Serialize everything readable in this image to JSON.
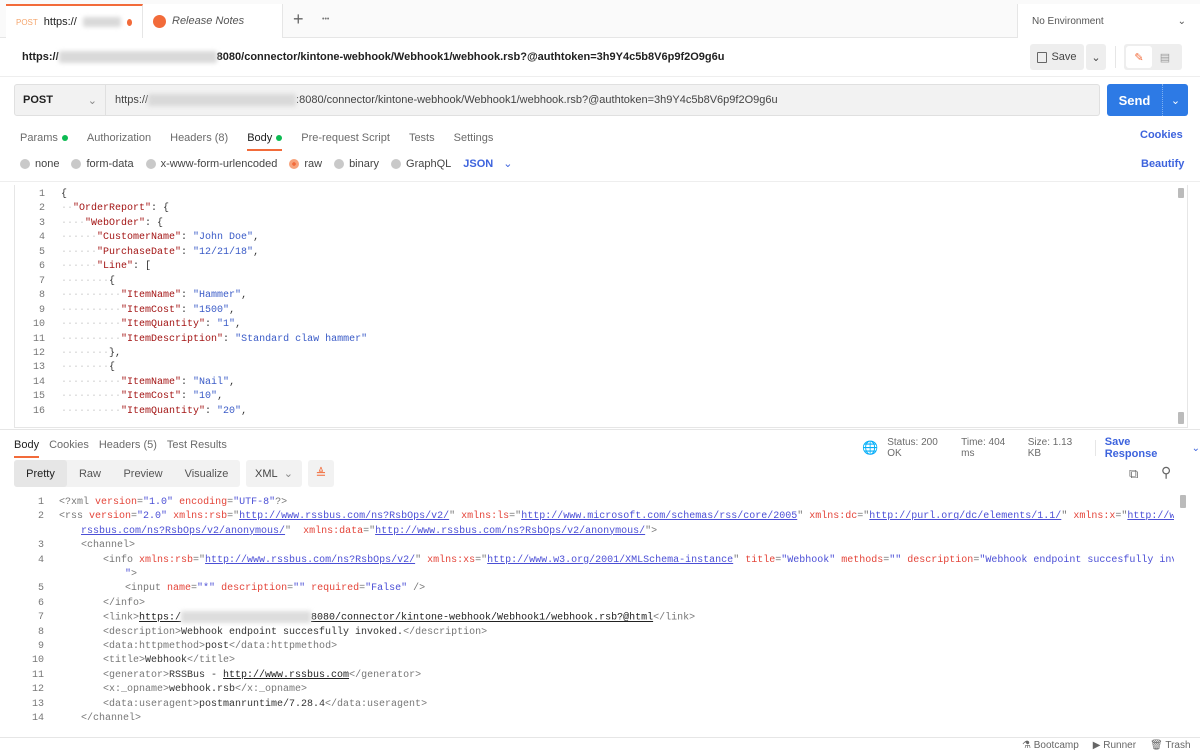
{
  "tabs": [
    {
      "method": "POST",
      "label": "https://",
      "unsaved": true
    },
    {
      "label": "Release Notes"
    }
  ],
  "new_tab": "+",
  "more_tabs": "•••",
  "environment": {
    "selected": "No Environment"
  },
  "title": {
    "prefix": "https://",
    "suffix": "8080/connector/kintone-webhook/Webhook1/webhook.rsb?@authtoken=3h9Y4c5b8V6p9f2O9g6u"
  },
  "save_label": "Save",
  "request": {
    "method": "POST",
    "url_prefix": "https://",
    "url_suffix": ":8080/connector/kintone-webhook/Webhook1/webhook.rsb?@authtoken=3h9Y4c5b8V6p9f2O9g6u",
    "send_label": "Send"
  },
  "req_tabs": [
    "Params",
    "Authorization",
    "Headers (8)",
    "Body",
    "Pre-request Script",
    "Tests",
    "Settings"
  ],
  "cookies_label": "Cookies",
  "body_types": [
    "none",
    "form-data",
    "x-www-form-urlencoded",
    "raw",
    "binary",
    "GraphQL"
  ],
  "body_format": "JSON",
  "beautify_label": "Beautify",
  "request_body": [
    {
      "n": "1",
      "i": 0,
      "t": [
        [
          "pu",
          "{"
        ]
      ]
    },
    {
      "n": "2",
      "i": 2,
      "t": [
        [
          "k",
          "\"OrderReport\""
        ],
        [
          "pu",
          ": {"
        ]
      ]
    },
    {
      "n": "3",
      "i": 4,
      "t": [
        [
          "k",
          "\"WebOrder\""
        ],
        [
          "pu",
          ": {"
        ]
      ]
    },
    {
      "n": "4",
      "i": 6,
      "t": [
        [
          "k",
          "\"CustomerName\""
        ],
        [
          "pu",
          ": "
        ],
        [
          "v",
          "\"John Doe\""
        ],
        [
          "pu",
          ","
        ]
      ]
    },
    {
      "n": "5",
      "i": 6,
      "t": [
        [
          "k",
          "\"PurchaseDate\""
        ],
        [
          "pu",
          ": "
        ],
        [
          "v",
          "\"12/21/18\""
        ],
        [
          "pu",
          ","
        ]
      ]
    },
    {
      "n": "6",
      "i": 6,
      "t": [
        [
          "k",
          "\"Line\""
        ],
        [
          "pu",
          ": ["
        ]
      ]
    },
    {
      "n": "7",
      "i": 8,
      "t": [
        [
          "pu",
          "{"
        ]
      ]
    },
    {
      "n": "8",
      "i": 10,
      "t": [
        [
          "k",
          "\"ItemName\""
        ],
        [
          "pu",
          ": "
        ],
        [
          "v",
          "\"Hammer\""
        ],
        [
          "pu",
          ","
        ]
      ]
    },
    {
      "n": "9",
      "i": 10,
      "t": [
        [
          "k",
          "\"ItemCost\""
        ],
        [
          "pu",
          ": "
        ],
        [
          "v",
          "\"1500\""
        ],
        [
          "pu",
          ","
        ]
      ]
    },
    {
      "n": "10",
      "i": 10,
      "t": [
        [
          "k",
          "\"ItemQuantity\""
        ],
        [
          "pu",
          ": "
        ],
        [
          "v",
          "\"1\""
        ],
        [
          "pu",
          ","
        ]
      ]
    },
    {
      "n": "11",
      "i": 10,
      "t": [
        [
          "k",
          "\"ItemDescription\""
        ],
        [
          "pu",
          ": "
        ],
        [
          "v",
          "\"Standard claw hammer\""
        ]
      ]
    },
    {
      "n": "12",
      "i": 8,
      "t": [
        [
          "pu",
          "},"
        ]
      ]
    },
    {
      "n": "13",
      "i": 8,
      "t": [
        [
          "pu",
          "{"
        ]
      ]
    },
    {
      "n": "14",
      "i": 10,
      "t": [
        [
          "k",
          "\"ItemName\""
        ],
        [
          "pu",
          ": "
        ],
        [
          "v",
          "\"Nail\""
        ],
        [
          "pu",
          ","
        ]
      ]
    },
    {
      "n": "15",
      "i": 10,
      "t": [
        [
          "k",
          "\"ItemCost\""
        ],
        [
          "pu",
          ": "
        ],
        [
          "v",
          "\"10\""
        ],
        [
          "pu",
          ","
        ]
      ]
    },
    {
      "n": "16",
      "i": 10,
      "t": [
        [
          "k",
          "\"ItemQuantity\""
        ],
        [
          "pu",
          ": "
        ],
        [
          "v",
          "\"20\""
        ],
        [
          "pu",
          ","
        ]
      ]
    }
  ],
  "resp_tabs": [
    "Body",
    "Cookies",
    "Headers (5)",
    "Test Results"
  ],
  "status": {
    "status": "Status: 200 OK",
    "time": "Time: 404 ms",
    "size": "Size: 1.13 KB"
  },
  "save_response_label": "Save Response",
  "view_modes": [
    "Pretty",
    "Raw",
    "Preview",
    "Visualize"
  ],
  "resp_format": "XML",
  "response_body": [
    {
      "n": "1",
      "i": 0,
      "t": [
        [
          "p",
          "<?xml "
        ],
        [
          "a",
          "version"
        ],
        [
          "p",
          "="
        ],
        [
          "s",
          "\"1.0\" "
        ],
        [
          "a",
          "encoding"
        ],
        [
          "p",
          "="
        ],
        [
          "s",
          "\"UTF-8\""
        ],
        [
          "p",
          "?>"
        ]
      ]
    },
    {
      "n": "2",
      "i": 0,
      "t": [
        [
          "p",
          "<rss "
        ],
        [
          "a",
          "version"
        ],
        [
          "p",
          "="
        ],
        [
          "s",
          "\"2.0\" "
        ],
        [
          "a",
          "xmlns:rsb"
        ],
        [
          "p",
          "=\""
        ],
        [
          "u",
          "http://www.rssbus.com/ns?RsbOps/v2/"
        ],
        [
          "p",
          "\" "
        ],
        [
          "a",
          "xmlns:ls"
        ],
        [
          "p",
          "=\""
        ],
        [
          "u",
          "http://www.microsoft.com/schemas/rss/core/2005"
        ],
        [
          "p",
          "\" "
        ],
        [
          "a",
          "xmlns:dc"
        ],
        [
          "p",
          "=\""
        ],
        [
          "u",
          "http://purl.org/dc/elements/1.1/"
        ],
        [
          "p",
          "\" "
        ],
        [
          "a",
          "xmlns:x"
        ],
        [
          "p",
          "=\""
        ],
        [
          "u",
          "http://www."
        ]
      ]
    },
    {
      "n": "",
      "i": 4,
      "t": [
        [
          "u",
          "rssbus.com/ns?RsbOps/v2/anonymous/"
        ],
        [
          "p",
          "\"  "
        ],
        [
          "a",
          "xmlns:data"
        ],
        [
          "p",
          "=\""
        ],
        [
          "u",
          "http://www.rssbus.com/ns?RsbOps/v2/anonymous/"
        ],
        [
          "p",
          "\">"
        ]
      ]
    },
    {
      "n": "3",
      "i": 4,
      "t": [
        [
          "p",
          "<channel>"
        ]
      ]
    },
    {
      "n": "4",
      "i": 8,
      "t": [
        [
          "p",
          "<info "
        ],
        [
          "a",
          "xmlns:rsb"
        ],
        [
          "p",
          "=\""
        ],
        [
          "u",
          "http://www.rssbus.com/ns?RsbOps/v2/"
        ],
        [
          "p",
          "\" "
        ],
        [
          "a",
          "xmlns:xs"
        ],
        [
          "p",
          "=\""
        ],
        [
          "u",
          "http://www.w3.org/2001/XMLSchema-instance"
        ],
        [
          "p",
          "\" "
        ],
        [
          "a",
          "title"
        ],
        [
          "p",
          "="
        ],
        [
          "s",
          "\"Webhook\" "
        ],
        [
          "a",
          "methods"
        ],
        [
          "p",
          "="
        ],
        [
          "s",
          "\"\" "
        ],
        [
          "a",
          "description"
        ],
        [
          "p",
          "="
        ],
        [
          "s",
          "\"Webhook endpoint succesfully invoked."
        ]
      ]
    },
    {
      "n": "",
      "i": 12,
      "t": [
        [
          "s",
          "\""
        ],
        [
          "p",
          ">"
        ]
      ]
    },
    {
      "n": "5",
      "i": 12,
      "t": [
        [
          "p",
          "<input "
        ],
        [
          "a",
          "name"
        ],
        [
          "p",
          "="
        ],
        [
          "s",
          "\"*\" "
        ],
        [
          "a",
          "description"
        ],
        [
          "p",
          "="
        ],
        [
          "s",
          "\"\" "
        ],
        [
          "a",
          "required"
        ],
        [
          "p",
          "="
        ],
        [
          "s",
          "\"False\" "
        ],
        [
          "p",
          "/>"
        ]
      ]
    },
    {
      "n": "6",
      "i": 8,
      "t": [
        [
          "p",
          "</info>"
        ]
      ]
    },
    {
      "n": "7",
      "i": 8,
      "t": [
        [
          "p",
          "<link>"
        ],
        [
          "tu",
          "https:/"
        ],
        [
          "blur",
          ""
        ],
        [
          "tu",
          "8080/connector/kintone-webhook/Webhook1/webhook.rsb?@html"
        ],
        [
          "p",
          "</link>"
        ]
      ]
    },
    {
      "n": "8",
      "i": 8,
      "t": [
        [
          "p",
          "<description>"
        ],
        [
          "t",
          "Webhook endpoint succesfully invoked."
        ],
        [
          "p",
          "</description>"
        ]
      ]
    },
    {
      "n": "9",
      "i": 8,
      "t": [
        [
          "p",
          "<data:httpmethod>"
        ],
        [
          "t",
          "post"
        ],
        [
          "p",
          "</data:httpmethod>"
        ]
      ]
    },
    {
      "n": "10",
      "i": 8,
      "t": [
        [
          "p",
          "<title>"
        ],
        [
          "t",
          "Webhook"
        ],
        [
          "p",
          "</title>"
        ]
      ]
    },
    {
      "n": "11",
      "i": 8,
      "t": [
        [
          "p",
          "<generator>"
        ],
        [
          "t",
          "RSSBus - "
        ],
        [
          "tu",
          "http://www.rssbus.com"
        ],
        [
          "p",
          "</generator>"
        ]
      ]
    },
    {
      "n": "12",
      "i": 8,
      "t": [
        [
          "p",
          "<x:_opname>"
        ],
        [
          "t",
          "webhook.rsb"
        ],
        [
          "p",
          "</x:_opname>"
        ]
      ]
    },
    {
      "n": "13",
      "i": 8,
      "t": [
        [
          "p",
          "<data:useragent>"
        ],
        [
          "t",
          "postmanruntime/7.28.4"
        ],
        [
          "p",
          "</data:useragent>"
        ]
      ]
    },
    {
      "n": "14",
      "i": 4,
      "t": [
        [
          "p",
          "</channel>"
        ]
      ]
    }
  ],
  "footer": [
    "Bootcamp",
    "Runner",
    "Trash"
  ],
  "colors": {
    "accent": "#f26b3a",
    "send": "#2d7ae5",
    "link": "#3d63dd",
    "success": "#0cbb52"
  }
}
